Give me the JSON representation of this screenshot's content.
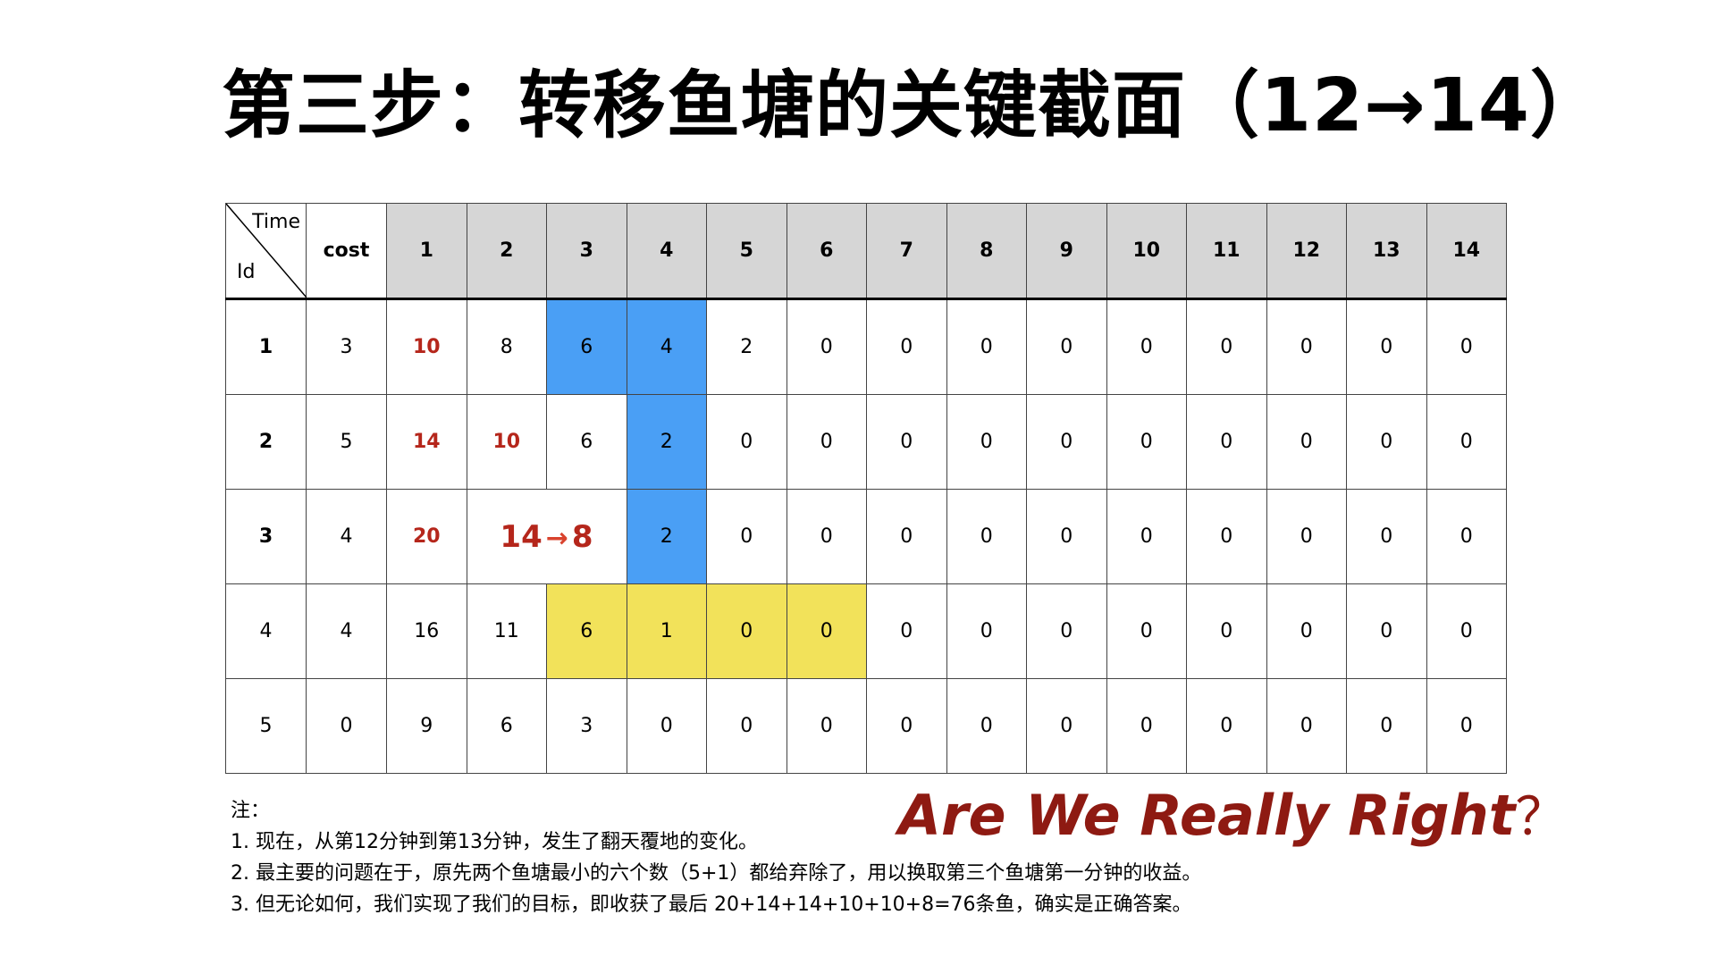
{
  "title": "第三步：转移鱼塘的关键截面（12→14）",
  "table": {
    "corner_time": "Time",
    "corner_id": "Id",
    "cost_header": "cost",
    "time_headers": [
      "1",
      "2",
      "3",
      "4",
      "5",
      "6",
      "7",
      "8",
      "9",
      "10",
      "11",
      "12",
      "13",
      "14"
    ],
    "rows": [
      {
        "id": "1",
        "cost": "3",
        "cells": [
          "10",
          "8",
          "6",
          "4",
          "2",
          "0",
          "0",
          "0",
          "0",
          "0",
          "0",
          "0",
          "0",
          "0"
        ]
      },
      {
        "id": "2",
        "cost": "5",
        "cells": [
          "14",
          "10",
          "6",
          "2",
          "0",
          "0",
          "0",
          "0",
          "0",
          "0",
          "0",
          "0",
          "0",
          "0"
        ]
      },
      {
        "id": "3",
        "cost": "4",
        "cells": [
          "20",
          "14",
          "8",
          "2",
          "0",
          "0",
          "0",
          "0",
          "0",
          "0",
          "0",
          "0",
          "0",
          "0"
        ]
      },
      {
        "id": "4",
        "cost": "4",
        "cells": [
          "16",
          "11",
          "6",
          "1",
          "0",
          "0",
          "0",
          "0",
          "0",
          "0",
          "0",
          "0",
          "0",
          "0"
        ]
      },
      {
        "id": "5",
        "cost": "0",
        "cells": [
          "9",
          "6",
          "3",
          "0",
          "0",
          "0",
          "0",
          "0",
          "0",
          "0",
          "0",
          "0",
          "0",
          "0"
        ]
      }
    ],
    "highlight_colors": {
      "red_text": "#b5261b",
      "blue": "#4a9ff5",
      "yellow": "#f2e25a"
    }
  },
  "notes": {
    "heading": "注：",
    "items": [
      "1.  现在，从第12分钟到第13分钟，发生了翻天覆地的变化。",
      "2.  最主要的问题在于，原先两个鱼塘最小的六个数（5+1）都给弃除了，用以换取第三个鱼塘第一分钟的收益。",
      "3.  但无论如何，我们实现了我们的目标，即收获了最后 20+14+14+10+10+8=76条鱼，确实是正确答案。"
    ]
  },
  "question": {
    "text": "Are We Really Right",
    "mark": "？"
  }
}
